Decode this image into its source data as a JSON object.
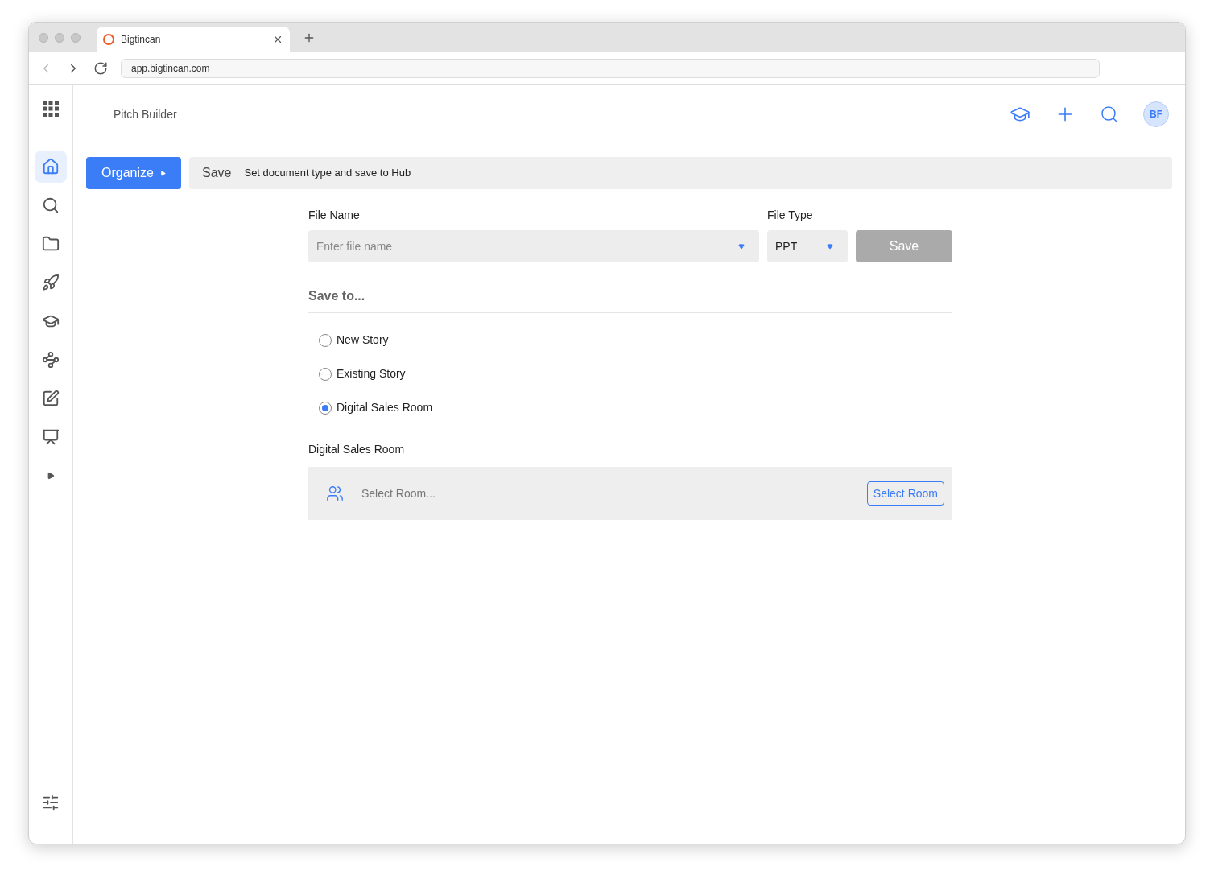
{
  "browser": {
    "tab_title": "Bigtincan",
    "url": "app.bigtincan.com"
  },
  "app": {
    "title": "Pitch Builder",
    "avatar_initials": "BF"
  },
  "sidebar": {
    "items": [
      {
        "kind": "home",
        "selected": true
      },
      {
        "kind": "search",
        "selected": false
      },
      {
        "kind": "folder",
        "selected": false
      },
      {
        "kind": "rocket",
        "selected": false
      },
      {
        "kind": "cap",
        "selected": false
      },
      {
        "kind": "strategy",
        "selected": false
      },
      {
        "kind": "edit",
        "selected": false
      },
      {
        "kind": "presentation",
        "selected": false
      },
      {
        "kind": "expand",
        "selected": false
      }
    ]
  },
  "steps": {
    "previous": "Organize",
    "current": "Save",
    "description": "Set document type and save to Hub"
  },
  "form": {
    "file_name": {
      "label": "File Name",
      "placeholder": "Enter file name"
    },
    "file_type": {
      "label": "File Type",
      "value": "PPT"
    },
    "save_button": {
      "label": "Save",
      "disabled": true
    },
    "save_to": {
      "heading": "Save to...",
      "options": [
        {
          "label": "New Story",
          "selected": false
        },
        {
          "label": "Existing Story",
          "selected": false
        },
        {
          "label": "Digital Sales Room",
          "selected": true
        }
      ]
    },
    "room": {
      "label": "Digital Sales Room",
      "placeholder": "Select Room...",
      "button": "Select Room"
    }
  }
}
